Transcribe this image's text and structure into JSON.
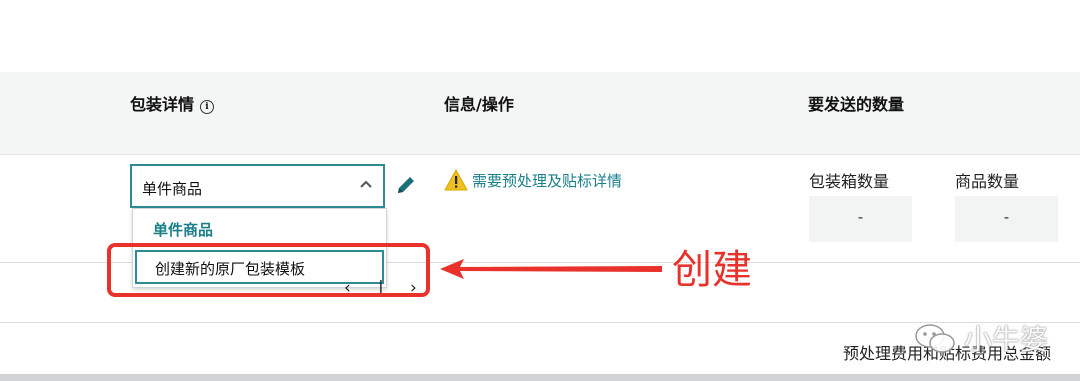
{
  "header": {
    "packaging_details": "包装详情",
    "info_action": "信息/操作",
    "quantity_to_send": "要发送的数量"
  },
  "select": {
    "value": "单件商品"
  },
  "dropdown": {
    "options": [
      "单件商品",
      "创建新的原厂包装模板"
    ]
  },
  "info": {
    "warning_link": "需要预处理及贴标详情"
  },
  "quantity": {
    "box_count_label": "包装箱数量",
    "box_count_value": "-",
    "item_count_label": "商品数量",
    "item_count_value": "-"
  },
  "annotation": {
    "label": "创建",
    "color": "#e8322b"
  },
  "footer": {
    "fees_text": "预处理费用和贴标费用总金额"
  },
  "watermark": {
    "text": "小牛婆"
  },
  "colors": {
    "accent": "#2e8b93",
    "link": "#1a7f8a",
    "warning": "#f0c020"
  }
}
